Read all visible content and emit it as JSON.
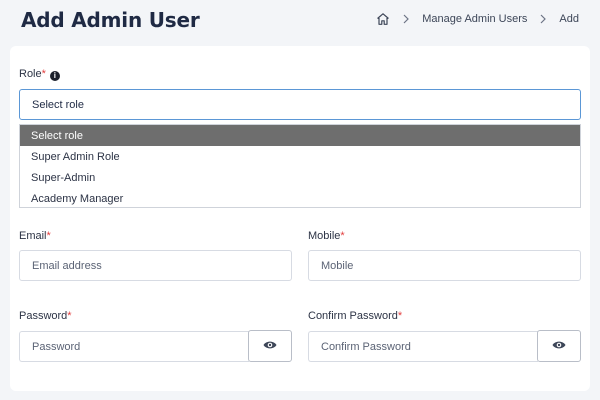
{
  "header": {
    "title": "Add Admin User",
    "breadcrumb": {
      "items": [
        "Manage Admin Users",
        "Add"
      ]
    }
  },
  "form": {
    "role": {
      "label": "Role",
      "required_mark": "*",
      "value": "Select role",
      "options": [
        "Select role",
        "Super Admin Role",
        "Super-Admin",
        "Academy Manager"
      ],
      "selected_option": "Select role"
    },
    "email": {
      "label": "Email",
      "required_mark": "*",
      "placeholder": "Email address"
    },
    "mobile": {
      "label": "Mobile",
      "required_mark": "*",
      "placeholder": "Mobile"
    },
    "password": {
      "label": "Password",
      "required_mark": "*",
      "placeholder": "Password"
    },
    "confirm_password": {
      "label": "Confirm Password",
      "required_mark": "*",
      "placeholder": "Confirm Password"
    }
  },
  "icons": {
    "home": "home-icon",
    "chevron": "chevron-right-icon",
    "info": "info-icon",
    "eye": "eye-icon"
  },
  "colors": {
    "required": "#e23d3d",
    "focus_border": "#5b97d6",
    "selected_option_bg": "#6e6e6e"
  }
}
